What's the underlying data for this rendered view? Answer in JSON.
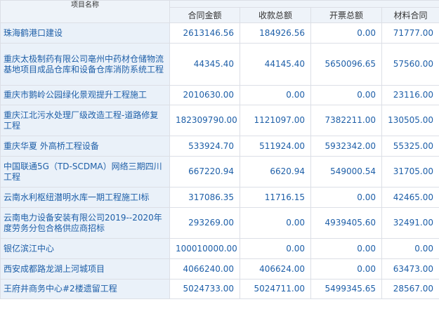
{
  "table": {
    "group_header": "",
    "columns": {
      "name": "项目名称",
      "contract_amount": "合同金额",
      "received_total": "收款总额",
      "invoiced_total": "开票总额",
      "material_contract": "材料合同"
    },
    "rows": [
      {
        "name": "珠海鹤港口建设",
        "contract_amount": "2613146.56",
        "received_total": "184926.56",
        "invoiced_total": "0.00",
        "material_contract": "71777.00"
      },
      {
        "name": "重庆太极制药有限公司亳州中药材仓储物流基地项目成品仓库和设备仓库消防系统工程",
        "contract_amount": "44345.40",
        "received_total": "44145.40",
        "invoiced_total": "5650096.65",
        "material_contract": "57560.00"
      },
      {
        "name": "重庆市鹅岭公园绿化景观提升工程施工",
        "contract_amount": "2010630.00",
        "received_total": "0.00",
        "invoiced_total": "0.00",
        "material_contract": "23116.00"
      },
      {
        "name": "重庆江北污水处理厂级改造工程-道路修复工程",
        "contract_amount": "182309790.00",
        "received_total": "1121097.00",
        "invoiced_total": "7382211.00",
        "material_contract": "130505.00"
      },
      {
        "name": "重庆华夏 外高桥工程设备",
        "contract_amount": "533924.70",
        "received_total": "511924.00",
        "invoiced_total": "5932342.00",
        "material_contract": "55325.00"
      },
      {
        "name": "中国联通5G（TD-SCDMA）网络三期四川工程",
        "contract_amount": "667220.94",
        "received_total": "6620.94",
        "invoiced_total": "549000.54",
        "material_contract": "31705.00"
      },
      {
        "name": "云南水利枢纽潜明水库一期工程施工I标",
        "contract_amount": "317086.35",
        "received_total": "11716.15",
        "invoiced_total": "0.00",
        "material_contract": "42465.00"
      },
      {
        "name": "云南电力设备安装有限公司2019--2020年度劳务分包合格供应商招标",
        "contract_amount": "293269.00",
        "received_total": "0.00",
        "invoiced_total": "4939405.60",
        "material_contract": "32491.00"
      },
      {
        "name": "银亿滨江中心",
        "contract_amount": "100010000.00",
        "received_total": "0.00",
        "invoiced_total": "0.00",
        "material_contract": "0.00"
      },
      {
        "name": "西安成都路龙湖上河城项目",
        "contract_amount": "4066240.00",
        "received_total": "406624.00",
        "invoiced_total": "0.00",
        "material_contract": "63473.00"
      },
      {
        "name": "王府井商务中心#2楼遗留工程",
        "contract_amount": "5024733.00",
        "received_total": "5024711.00",
        "invoiced_total": "5499345.65",
        "material_contract": "28567.00"
      }
    ]
  }
}
